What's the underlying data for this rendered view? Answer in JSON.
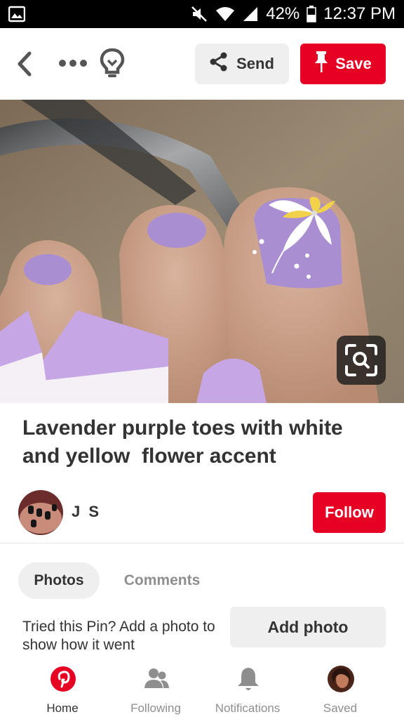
{
  "status_bar": {
    "battery": "42%",
    "time": "12:37 PM",
    "icons": [
      "image-icon",
      "mute-icon",
      "wifi-icon",
      "signal-icon",
      "battery-icon"
    ]
  },
  "top_nav": {
    "icons": [
      "back-icon",
      "more-icon",
      "lightbulb-icon"
    ],
    "send_label": "Send",
    "save_label": "Save"
  },
  "pin": {
    "title": "Lavender purple toes with white\nand yellow  flower accent",
    "author": "J S",
    "follow_label": "Follow"
  },
  "tabs": {
    "photos_label": "Photos",
    "comments_label": "Comments"
  },
  "tried": {
    "text": "Tried this Pin? Add a photo to show how it went",
    "add_photo_label": "Add photo"
  },
  "bottom_nav": {
    "items": [
      {
        "label": "Home",
        "icon": "pinterest-logo-icon",
        "active": true
      },
      {
        "label": "Following",
        "icon": "people-icon",
        "active": false
      },
      {
        "label": "Notifications",
        "icon": "bell-icon",
        "active": false
      },
      {
        "label": "Saved",
        "icon": "profile-avatar-icon",
        "active": false
      }
    ]
  },
  "colors": {
    "brand_red": "#e60023",
    "nail_lavender": "#a98fd2",
    "button_gray": "#efefef"
  }
}
